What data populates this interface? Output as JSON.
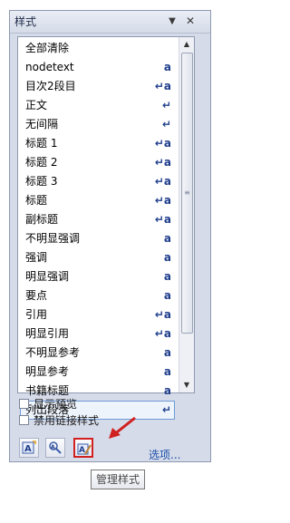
{
  "pane": {
    "title": "样式",
    "menu_glyph": "▼",
    "close_glyph": "✕"
  },
  "styles": [
    {
      "name": "全部清除",
      "type": ""
    },
    {
      "name": "nodetext",
      "type": "a"
    },
    {
      "name": "目次2段目",
      "type": "↵a"
    },
    {
      "name": "正文",
      "type": "↵"
    },
    {
      "name": "无间隔",
      "type": "↵"
    },
    {
      "name": "标题 1",
      "type": "↵a"
    },
    {
      "name": "标题 2",
      "type": "↵a"
    },
    {
      "name": "标题 3",
      "type": "↵a"
    },
    {
      "name": "标题",
      "type": "↵a"
    },
    {
      "name": "副标题",
      "type": "↵a"
    },
    {
      "name": "不明显强调",
      "type": "a"
    },
    {
      "name": "强调",
      "type": "a"
    },
    {
      "name": "明显强调",
      "type": "a"
    },
    {
      "name": "要点",
      "type": "a"
    },
    {
      "name": "引用",
      "type": "↵a"
    },
    {
      "name": "明显引用",
      "type": "↵a"
    },
    {
      "name": "不明显参考",
      "type": "a"
    },
    {
      "name": "明显参考",
      "type": "a"
    },
    {
      "name": "书籍标题",
      "type": "a"
    },
    {
      "name": "列出段落",
      "type": "↵",
      "selected": true
    }
  ],
  "scrollbar": {
    "up_glyph": "▲",
    "down_glyph": "▼",
    "grip_glyph": "≡"
  },
  "checkboxes": {
    "show_preview": {
      "label": "显示预览",
      "checked": false
    },
    "disable_linked": {
      "label": "禁用链接样式",
      "checked": false
    }
  },
  "toolbar": {
    "new_style": {
      "icon": "new-style-icon"
    },
    "style_inspector": {
      "icon": "style-inspector-icon"
    },
    "manage_styles": {
      "icon": "manage-styles-icon"
    },
    "options_label": "选项..."
  },
  "tooltip": {
    "text": "管理样式"
  },
  "colors": {
    "pane_bg": "#d6dbe9",
    "link": "#1a4fa8",
    "type_glyph": "#1f3e8c",
    "highlight": "#d02020"
  }
}
